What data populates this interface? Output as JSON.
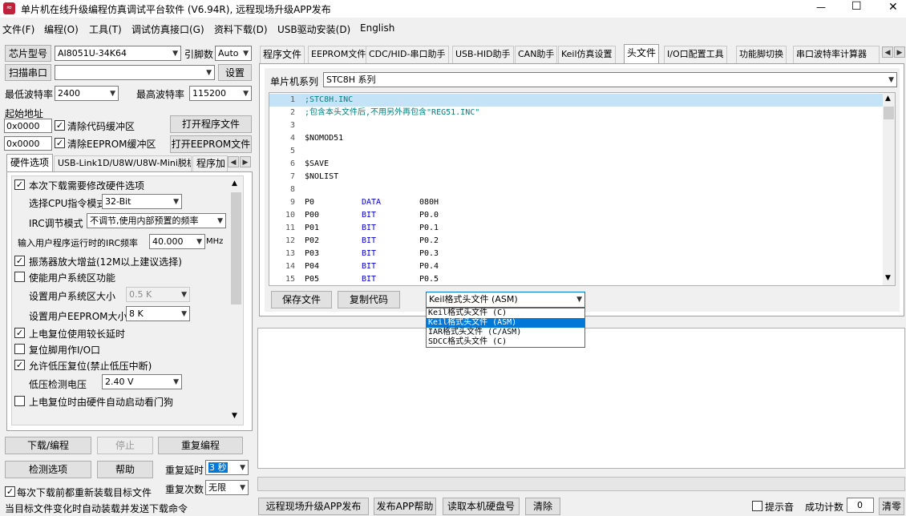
{
  "window": {
    "title": "单片机在线升级编程仿真调试平台软件 (V6.94R), 远程现场升级APP发布",
    "min": "—",
    "max": "☐",
    "close": "✕"
  },
  "menu": [
    "文件(F)",
    "编程(O)",
    "工具(T)",
    "调试仿真接口(G)",
    "资料下载(D)",
    "USB驱动安装(D)",
    "English"
  ],
  "left": {
    "chip_btn": "芯片型号",
    "chip_value": "AI8051U-34K64",
    "pins_label": "引脚数",
    "pins_value": "Auto",
    "scan_btn": "扫描串口",
    "port_value": "",
    "settings_btn": "设置",
    "min_baud_label": "最低波特率",
    "min_baud": "2400",
    "max_baud_label": "最高波特率",
    "max_baud": "115200",
    "start_addr_label": "起始地址",
    "addr1": "0x0000",
    "clear_code": "清除代码缓冲区",
    "open_prog": "打开程序文件",
    "addr2": "0x0000",
    "clear_eeprom": "清除EEPROM缓冲区",
    "open_eeprom": "打开EEPROM文件",
    "tabs": [
      "硬件选项",
      "USB-Link1D/U8W/U8W-Mini脱机",
      "程序加"
    ],
    "hw": {
      "opt1": "本次下载需要修改硬件选项",
      "cpu_mode_label": "选择CPU指令模式",
      "cpu_mode": "32-Bit",
      "irc_mode_label": "IRC调节模式",
      "irc_mode": "不调节,使用内部预置的频率",
      "irc_freq_label": "输入用户程序运行时的IRC频率",
      "irc_freq": "40.000",
      "mhz": "MHz",
      "osc": "振荡器放大增益(12M以上建议选择)",
      "sys_area": "使能用户系统区功能",
      "sys_size_label": "设置用户系统区大小",
      "sys_size": "0.5 K",
      "eeprom_size_label": "设置用户EEPROM大小",
      "eeprom_size": "8   K",
      "power_delay": "上电复位使用较长延时",
      "reset_io": "复位脚用作I/O口",
      "lvr": "允许低压复位(禁止低压中断)",
      "lvd_label": "低压检测电压",
      "lvd": "2.40 V",
      "wdt": "上电复位时由硬件自动启动看门狗"
    },
    "download_btn": "下载/编程",
    "stop_btn": "停止",
    "reprog_btn": "重复编程",
    "detect_btn": "检测选项",
    "help_btn": "帮助",
    "repeat_delay_label": "重复延时",
    "repeat_delay": "3 秒",
    "repeat_count_label": "重复次数",
    "repeat_count": "无限",
    "reload1": "每次下载前都重新装载目标文件",
    "reload2": "当目标文件变化时自动装载并发送下载命令"
  },
  "right": {
    "tabs": [
      "程序文件",
      "EEPROM文件",
      "CDC/HID-串口助手",
      "USB-HID助手",
      "CAN助手",
      "Keil仿真设置",
      "头文件",
      "I/O口配置工具",
      "功能脚切换",
      "串口波特率计算器"
    ],
    "series_label": "单片机系列",
    "series": "STC8H 系列",
    "code": [
      {
        "n": "1",
        "t": ";STC8H.INC",
        "c": "cm"
      },
      {
        "n": "2",
        "t": ";包含本头文件后,不用另外再包含\"REG51.INC\"",
        "c": "cm"
      },
      {
        "n": "3",
        "t": "",
        "c": ""
      },
      {
        "n": "4",
        "t": "$NOMOD51",
        "c": ""
      },
      {
        "n": "5",
        "t": "",
        "c": ""
      },
      {
        "n": "6",
        "t": "$SAVE",
        "c": ""
      },
      {
        "n": "7",
        "t": "$NOLIST",
        "c": ""
      },
      {
        "n": "8",
        "t": "",
        "c": ""
      },
      {
        "n": "9",
        "t": "P0",
        "k": "DATA",
        "v": "080H"
      },
      {
        "n": "10",
        "t": "P00",
        "k": "BIT",
        "v": "P0.0"
      },
      {
        "n": "11",
        "t": "P01",
        "k": "BIT",
        "v": "P0.1"
      },
      {
        "n": "12",
        "t": "P02",
        "k": "BIT",
        "v": "P0.2"
      },
      {
        "n": "13",
        "t": "P03",
        "k": "BIT",
        "v": "P0.3"
      },
      {
        "n": "14",
        "t": "P04",
        "k": "BIT",
        "v": "P0.4"
      },
      {
        "n": "15",
        "t": "P05",
        "k": "BIT",
        "v": "P0.5"
      }
    ],
    "save_btn": "保存文件",
    "copy_btn": "复制代码",
    "format_value": "Keil格式头文件 (ASM)",
    "format_options": [
      "Keil格式头文件 (C)",
      "Keil格式头文件 (ASM)",
      "IAR格式头文件 (C/ASM)",
      "SDCC格式头文件 (C)"
    ]
  },
  "bottom": {
    "remote_btn": "远程现场升级APP发布",
    "publish_help_btn": "发布APP帮助",
    "read_disk_btn": "读取本机硬盘号",
    "clear_btn": "清除",
    "beep_label": "提示音",
    "count_label": "成功计数",
    "count": "0",
    "clear2_btn": "清零"
  },
  "colors": {
    "selection": "#0078d7",
    "line_highlight": "#c5e3f6",
    "keyword": "#0000cc",
    "comment": "#008080"
  }
}
